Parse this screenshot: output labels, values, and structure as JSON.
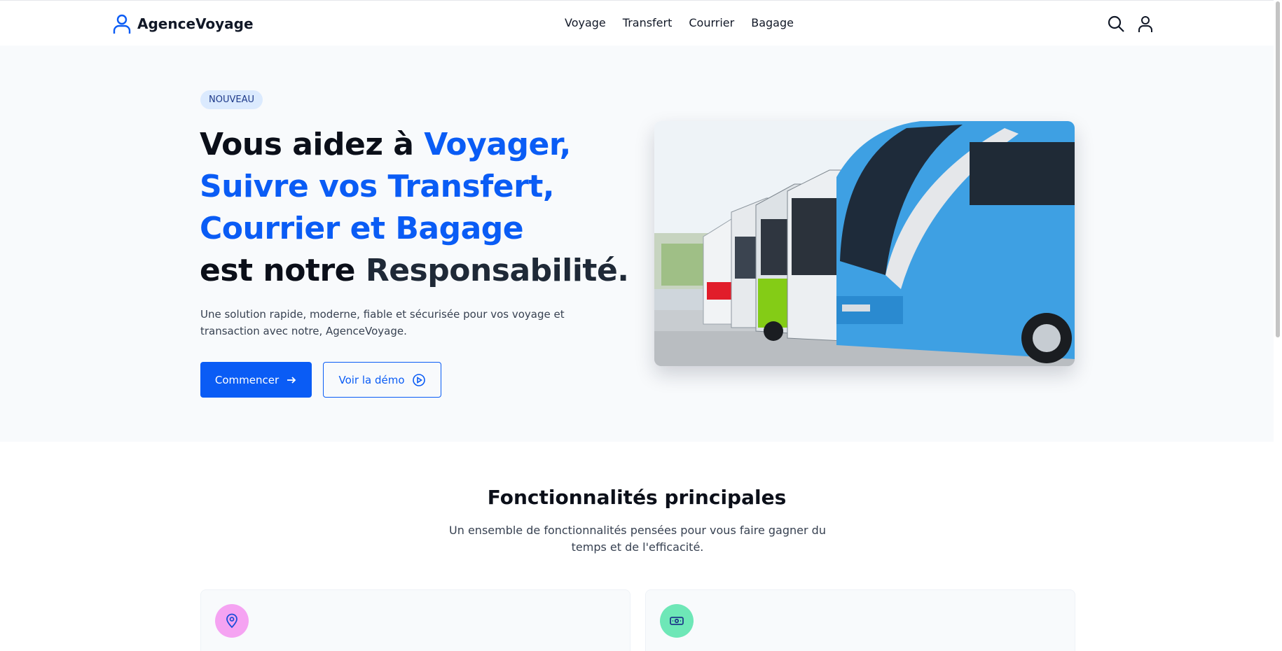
{
  "brand": {
    "name": "AgenceVoyage",
    "icon": "user-icon",
    "accent": "#0a5cf5"
  },
  "nav": {
    "items": [
      {
        "label": "Voyage"
      },
      {
        "label": "Transfert"
      },
      {
        "label": "Courrier"
      },
      {
        "label": "Bagage"
      }
    ]
  },
  "header_actions": {
    "search_icon": "search-icon",
    "account_icon": "user-icon"
  },
  "hero": {
    "badge": "NOUVEAU",
    "title": {
      "part1": "Vous aidez à ",
      "highlight1": "Voyager,",
      "highlight2": "Suivre vos Transfert,",
      "highlight3": "Courrier et Bagage",
      "part2": "est notre ",
      "part3": "Responsabilité."
    },
    "description": "Une solution rapide, moderne, fiable et sécurisée pour vos voyage et transaction avec notre, AgenceVoyage.",
    "primary_button": "Commencer",
    "secondary_button": "Voir la démo",
    "image_subject": "buses-image"
  },
  "features": {
    "title": "Fonctionnalités principales",
    "subtitle": "Un ensemble de fonctionnalités pensées pour vous faire gagner du temps et de l'efficacité.",
    "cards": [
      {
        "icon": "map-pin-icon",
        "color": "#f5a3f2"
      },
      {
        "icon": "money-icon",
        "color": "#6ee7b7"
      }
    ]
  }
}
